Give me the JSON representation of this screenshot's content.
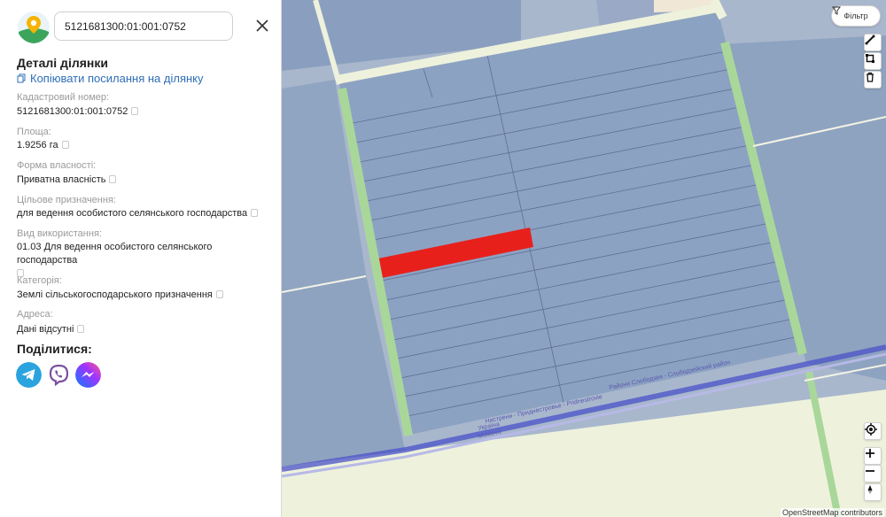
{
  "search": {
    "value": "5121681300:01:001:0752"
  },
  "details": {
    "title": "Деталі ділянки",
    "copy_link": "Копіювати посилання на ділянку"
  },
  "fields": [
    {
      "label": "Кадастровий номер:",
      "value": "5121681300:01:001:0752"
    },
    {
      "label": "Площа:",
      "value": "1.9256 га"
    },
    {
      "label": "Форма власності:",
      "value": "Приватна власність"
    },
    {
      "label": "Цільове призначення:",
      "value": "для ведення особистого селянського господарства"
    },
    {
      "label": "Вид використання:",
      "value": "01.03 Для ведення особистого селянського господарства"
    },
    {
      "label": "Категорія:",
      "value": "Землі сільськогосподарського призначення"
    },
    {
      "label": "Адреса:",
      "value": "Дані відсутні"
    }
  ],
  "share": {
    "title": "Поділитися:",
    "buttons": [
      "telegram-icon",
      "viber-icon",
      "messenger-icon"
    ]
  },
  "map": {
    "filter_label": "Фільтр",
    "attribution": "OpenStreetMap contributors",
    "road_labels": [
      "Райони Слободзея - Слободзейский район",
      "Нистрени - Приднестровье - Pridnestrovie",
      "Україна",
      "Moldova"
    ],
    "colors": {
      "parcel_fill": "#8ca2c2",
      "selected_parcel": "#e8201c",
      "green_strip": "#a9d79a",
      "field": "#eef2dc",
      "boundary": "#4a52c8"
    }
  }
}
